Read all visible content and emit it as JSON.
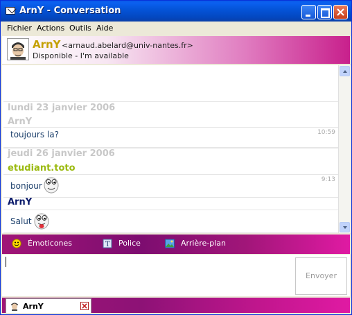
{
  "window": {
    "title": "ArnY - Conversation"
  },
  "menu": [
    "Fichier",
    "Actions",
    "Outils",
    "Aide"
  ],
  "contact": {
    "name": "ArnY",
    "email": "<arnaud.abelard@univ-nantes.fr>",
    "status": "Disponible - I'm available"
  },
  "conversation": {
    "day1": {
      "date": "lundi 23 janvier 2006",
      "sender": "ArnY",
      "message": "toujours la?",
      "time": "10:59"
    },
    "day2": {
      "date": "jeudi 26 janvier 2006",
      "sender1": "etudiant.toto",
      "message1": "bonjour",
      "time1": "9:13",
      "sender2": "ArnY",
      "message2": "Salut"
    }
  },
  "toolbar": {
    "emoticons": "Émoticones",
    "font": "Police",
    "background": "Arrière-plan"
  },
  "input": {
    "send_label": "Envoyer"
  },
  "tab": {
    "label": "ArnY"
  },
  "colors": {
    "accent_magenta": "#a01577",
    "contact_name": "#c4a000",
    "sender_toto": "#9bba10",
    "sender_arny": "#0a1a6a"
  }
}
